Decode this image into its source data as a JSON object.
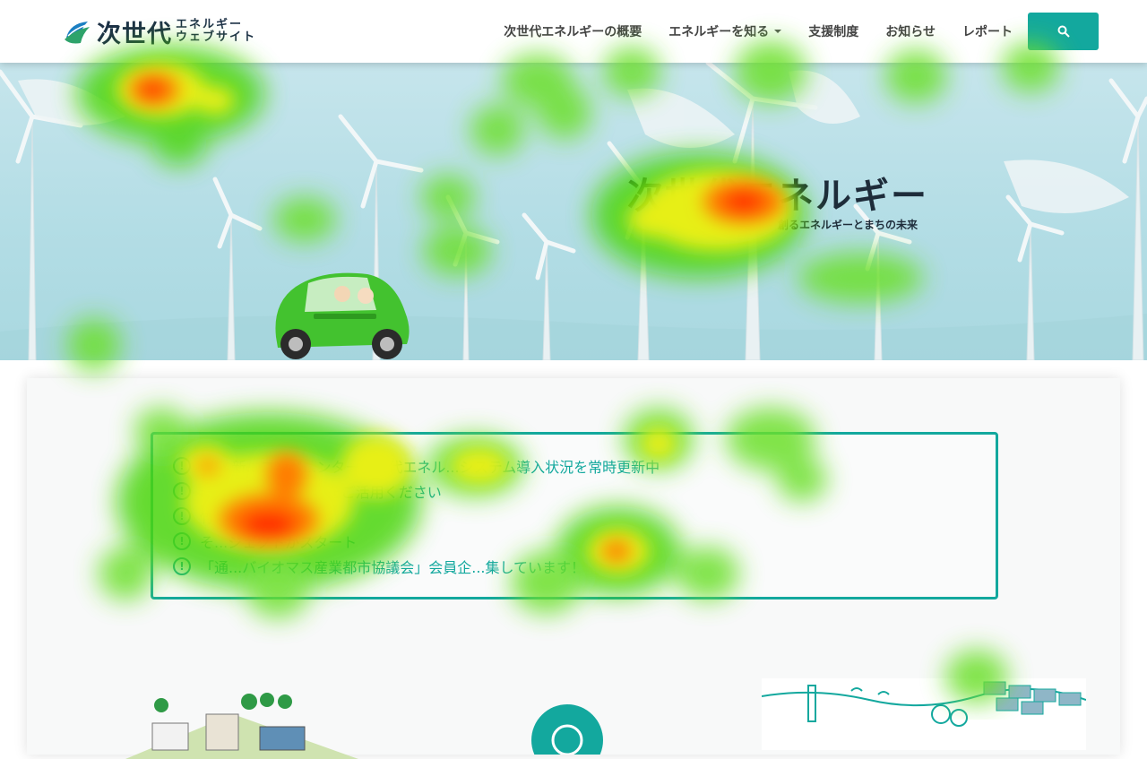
{
  "header": {
    "logo": {
      "main": "次世代",
      "sub_line1": "エネルギー",
      "sub_line2": "ウェブサイト"
    },
    "nav": [
      {
        "label": "次世代エネルギーの概要",
        "dropdown": false
      },
      {
        "label": "エネルギーを知る",
        "dropdown": true
      },
      {
        "label": "支援制度",
        "dropdown": false
      },
      {
        "label": "お知らせ",
        "dropdown": false
      },
      {
        "label": "レポート",
        "dropdown": false
      }
    ],
    "search_icon": "search-icon"
  },
  "hero": {
    "title": "次世代エネルギー",
    "subtitle": "創るエネルギーとまちの未来"
  },
  "news": {
    "items": [
      "WI...新...コンベ...ンター次世代エネル...システム導入状況を常時更新中",
      "...やさ...整備事業...をご活用ください",
      "竹...",
      "そ...ジェクトがスタート",
      "「通...バイオマス産業都市協議会」会員企...集しています！"
    ]
  },
  "colors": {
    "accent": "#13a89e",
    "navy": "#1d3146"
  }
}
